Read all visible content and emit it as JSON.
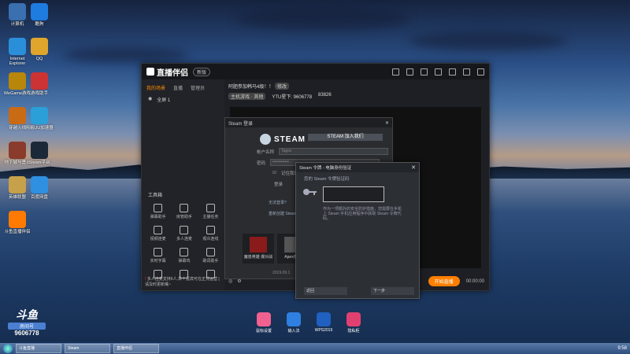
{
  "desktop": {
    "icons": [
      {
        "label": "计算机",
        "icon": "computer-icon",
        "color": "#3a6fb0"
      },
      {
        "label": "酷狗",
        "icon": "kugou-icon",
        "color": "#1e7be0"
      },
      {
        "label": "Internet Explorer",
        "icon": "ie-icon",
        "color": "#2b8ed8"
      },
      {
        "label": "QQ",
        "icon": "qq-icon",
        "color": "#e0a52b"
      },
      {
        "label": "WeGame游戏",
        "icon": "wegame-icon",
        "color": "#b8860b"
      },
      {
        "label": "游戏助手",
        "icon": "game-assistant-icon",
        "color": "#c33"
      },
      {
        "label": "穿越火线",
        "icon": "cf-icon",
        "color": "#c96b15"
      },
      {
        "label": "网易UU加速器",
        "icon": "uu-icon",
        "color": "#2a9fd8"
      },
      {
        "label": "地下城与勇士",
        "icon": "dnf-icon",
        "color": "#8a3b2b"
      },
      {
        "label": "Steam平台",
        "icon": "steam-icon",
        "color": "#1b2838"
      },
      {
        "label": "英雄联盟",
        "icon": "lol-icon",
        "color": "#c7a14a"
      },
      {
        "label": "百度网盘",
        "icon": "baidu-pan-icon",
        "color": "#2f8fe0"
      },
      {
        "label": "斗鱼直播伴侣",
        "icon": "douyu-icon",
        "color": "#ff7a00"
      }
    ],
    "dock": [
      {
        "label": "鼠标设置",
        "color": "#f06090"
      },
      {
        "label": "输入法",
        "color": "#2f7fe0"
      },
      {
        "label": "WPS2019",
        "color": "#2060c0"
      },
      {
        "label": "隐私柜",
        "color": "#e04070"
      }
    ],
    "douyu_logo": {
      "brand": "斗鱼",
      "sub": "房间号",
      "room": "9606778"
    }
  },
  "zhibo": {
    "title": "直播伴侣",
    "version_badge": "新版",
    "left_tabs": [
      "我的场景",
      "直播",
      "管理员"
    ],
    "scene": "全屏 1",
    "tools_title": "工具箱",
    "tools": [
      "弹幕助手",
      "房管助手",
      "主播任务",
      "视频连麦",
      "多人连麦",
      "观众连线",
      "实时字幕",
      "弹幕鸡",
      "歌词助手",
      "",
      "",
      ""
    ],
    "notice_icon": "!",
    "notice": "多人连麦支持6人,单个嘉宾可在正式运营 | 请及时更新嘴~",
    "room_title": "阿肥参加韩马4级！！",
    "edit_badge": "修改",
    "category": "主机游戏 · 其他",
    "ytu": "YTU星下: 9606778",
    "fans": "83826",
    "go_live": "开始直播",
    "timer": "00:00:00"
  },
  "steam_login": {
    "window_title": "Steam 登录",
    "logo": "STEAM",
    "join_tab": "STEAM 加入我们",
    "username_label": "帐户名称",
    "username_value": "Tagsx",
    "password_label": "密码",
    "password_value": "••••••••••••",
    "remember_label": "记住我的密码",
    "login_label": "登录",
    "forgot_link": "无法登录?",
    "retrieve_link": "重新创建 Steam 帐户",
    "tiles": [
      "魔兽英雄 爆对战",
      "Apex英雄"
    ],
    "bottom_ver": "2019.09.1"
  },
  "guard": {
    "window_title": "Steam 令牌 - 电脑身份验证",
    "subtitle": "您的 Steam 令牌验证码",
    "description": "作为一项额外的安全防护措施，您需要在手机上 Steam 手机应用程序中获取 Steam 令牌代码。",
    "back_button": "返回",
    "next_button": "下一步"
  },
  "taskbar": {
    "items": [
      "斗鱼直播",
      "Steam",
      "直播伴侣"
    ],
    "time": "9:58"
  }
}
